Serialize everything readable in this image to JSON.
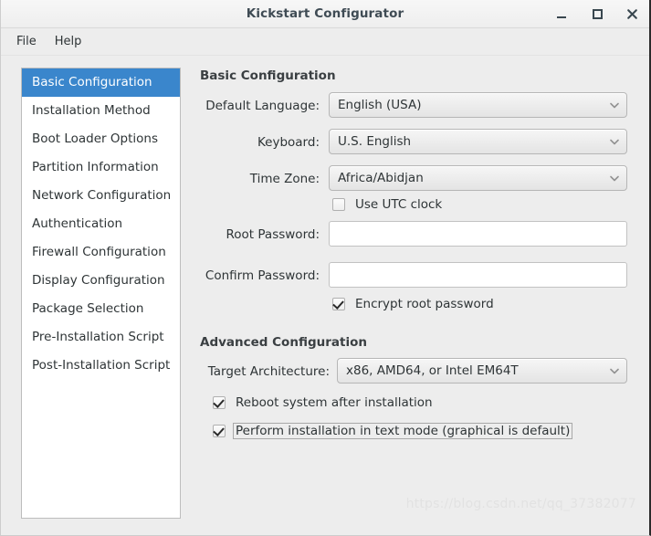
{
  "window": {
    "title": "Kickstart Configurator",
    "controls": {
      "minimize": "minimize",
      "maximize": "maximize",
      "close": "close"
    }
  },
  "menubar": {
    "items": [
      {
        "label": "File"
      },
      {
        "label": "Help"
      }
    ]
  },
  "sidebar": {
    "items": [
      {
        "label": "Basic Configuration",
        "selected": true
      },
      {
        "label": "Installation Method",
        "selected": false
      },
      {
        "label": "Boot Loader Options",
        "selected": false
      },
      {
        "label": "Partition Information",
        "selected": false
      },
      {
        "label": "Network Configuration",
        "selected": false
      },
      {
        "label": "Authentication",
        "selected": false
      },
      {
        "label": "Firewall Configuration",
        "selected": false
      },
      {
        "label": "Display Configuration",
        "selected": false
      },
      {
        "label": "Package Selection",
        "selected": false
      },
      {
        "label": "Pre-Installation Script",
        "selected": false
      },
      {
        "label": "Post-Installation Script",
        "selected": false
      }
    ]
  },
  "basic_configuration": {
    "heading": "Basic Configuration",
    "default_language": {
      "label": "Default Language:",
      "value": "English (USA)"
    },
    "keyboard": {
      "label": "Keyboard:",
      "value": "U.S. English"
    },
    "time_zone": {
      "label": "Time Zone:",
      "value": "Africa/Abidjan"
    },
    "use_utc_clock": {
      "label": "Use UTC clock",
      "checked": false
    },
    "root_password": {
      "label": "Root Password:",
      "value": "",
      "placeholder": ""
    },
    "confirm_password": {
      "label": "Confirm Password:",
      "value": "",
      "placeholder": ""
    },
    "encrypt_root_password": {
      "label": "Encrypt root password",
      "checked": true
    }
  },
  "advanced_configuration": {
    "heading": "Advanced Configuration",
    "target_architecture": {
      "label": "Target Architecture:",
      "value": "x86, AMD64, or Intel EM64T"
    },
    "reboot_after_install": {
      "label": "Reboot system after installation",
      "checked": true
    },
    "text_mode_install": {
      "label": "Perform installation in text mode (graphical is default)",
      "checked": true,
      "focused": true
    }
  },
  "watermark": {
    "text": "https://blog.csdn.net/qq_37382077"
  },
  "colors": {
    "selection_blue": "#3a86cc",
    "window_bg": "#ededed",
    "list_bg": "#ffffff",
    "text": "#2e3436",
    "title_text": "#3f4b54"
  }
}
